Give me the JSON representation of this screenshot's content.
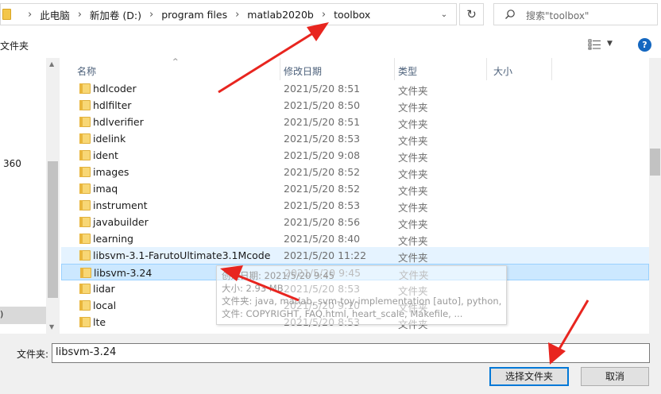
{
  "address_bar": {
    "breadcrumbs": [
      "此电脑",
      "新加卷 (D:)",
      "program files",
      "matlab2020b",
      "toolbox"
    ]
  },
  "search": {
    "placeholder": "搜索\"toolbox\""
  },
  "toolbar": {
    "new_folder_label": "文件夹",
    "help_label": "?"
  },
  "nav_pane": {
    "item_360": "360",
    "selected_item": ")"
  },
  "columns": {
    "name": "名称",
    "date": "修改日期",
    "type": "类型",
    "size": "大小"
  },
  "files": [
    {
      "name": "hdlcoder",
      "date": "2021/5/20 8:51",
      "type": "文件夹"
    },
    {
      "name": "hdlfilter",
      "date": "2021/5/20 8:50",
      "type": "文件夹"
    },
    {
      "name": "hdlverifier",
      "date": "2021/5/20 8:51",
      "type": "文件夹"
    },
    {
      "name": "idelink",
      "date": "2021/5/20 8:53",
      "type": "文件夹"
    },
    {
      "name": "ident",
      "date": "2021/5/20 9:08",
      "type": "文件夹"
    },
    {
      "name": "images",
      "date": "2021/5/20 8:52",
      "type": "文件夹"
    },
    {
      "name": "imaq",
      "date": "2021/5/20 8:52",
      "type": "文件夹"
    },
    {
      "name": "instrument",
      "date": "2021/5/20 8:53",
      "type": "文件夹"
    },
    {
      "name": "javabuilder",
      "date": "2021/5/20 8:56",
      "type": "文件夹"
    },
    {
      "name": "learning",
      "date": "2021/5/20 8:40",
      "type": "文件夹"
    },
    {
      "name": "libsvm-3.1-FarutoUltimate3.1Mcode",
      "date": "2021/5/20 11:22",
      "type": "文件夹",
      "state": "hover"
    },
    {
      "name": "libsvm-3.24",
      "date": "2021/5/20 9:45",
      "type": "文件夹",
      "state": "selected"
    },
    {
      "name": "lidar",
      "date": "2021/5/20 8:53",
      "type": "文件夹"
    },
    {
      "name": "local",
      "date": "2021/5/20 9:10",
      "type": "文件夹"
    },
    {
      "name": "lte",
      "date": "2021/5/20 8:53",
      "type": "文件夹"
    }
  ],
  "tooltip": {
    "lines": [
      "创建日期: 2021/5/20 9:45",
      "大小: 2.93 MB",
      "文件夹: java, matlab, svm-toy-implementation [auto], python, ...",
      "文件: COPYRIGHT, FAQ.html, heart_scale, Makefile, ..."
    ]
  },
  "bottom": {
    "folder_label": "文件夹:",
    "folder_value": "libsvm-3.24",
    "select_button": "选择文件夹",
    "cancel_button": "取消"
  },
  "colors": {
    "accent": "#0078d7",
    "selected_row": "#cce8ff",
    "hover_row": "#e5f3ff",
    "annotation_arrow": "#e8251f"
  }
}
